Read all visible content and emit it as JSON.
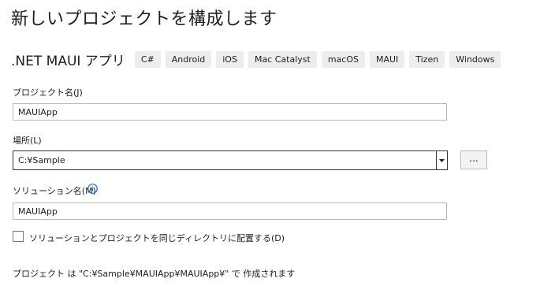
{
  "page": {
    "title": "新しいプロジェクトを構成します"
  },
  "template": {
    "name": ".NET MAUI アプリ",
    "tags": [
      "C#",
      "Android",
      "iOS",
      "Mac Catalyst",
      "macOS",
      "MAUI",
      "Tizen",
      "Windows"
    ]
  },
  "project_name": {
    "label": "プロジェクト名(J)",
    "value": "MAUIApp"
  },
  "location": {
    "label": "場所(L)",
    "value": "C:¥Sample",
    "dropdown_icon": "caret-down-icon",
    "browse_label": "..."
  },
  "solution_name": {
    "label": "ソリューション名(M)",
    "value": "MAUIApp",
    "info_icon": "info-circle-icon"
  },
  "same_directory": {
    "label": "ソリューションとプロジェクトを同じディレクトリに配置する(D)",
    "checked": false
  },
  "footer": {
    "location_note": "プロジェクト は \"C:¥Sample¥MAUIApp¥MAUIApp¥\" で 作成されます"
  },
  "colors": {
    "tag_background": "#ededed",
    "info_icon": "#1a73c8",
    "input_border": "#b9b9b9",
    "focused_border": "#333333"
  }
}
